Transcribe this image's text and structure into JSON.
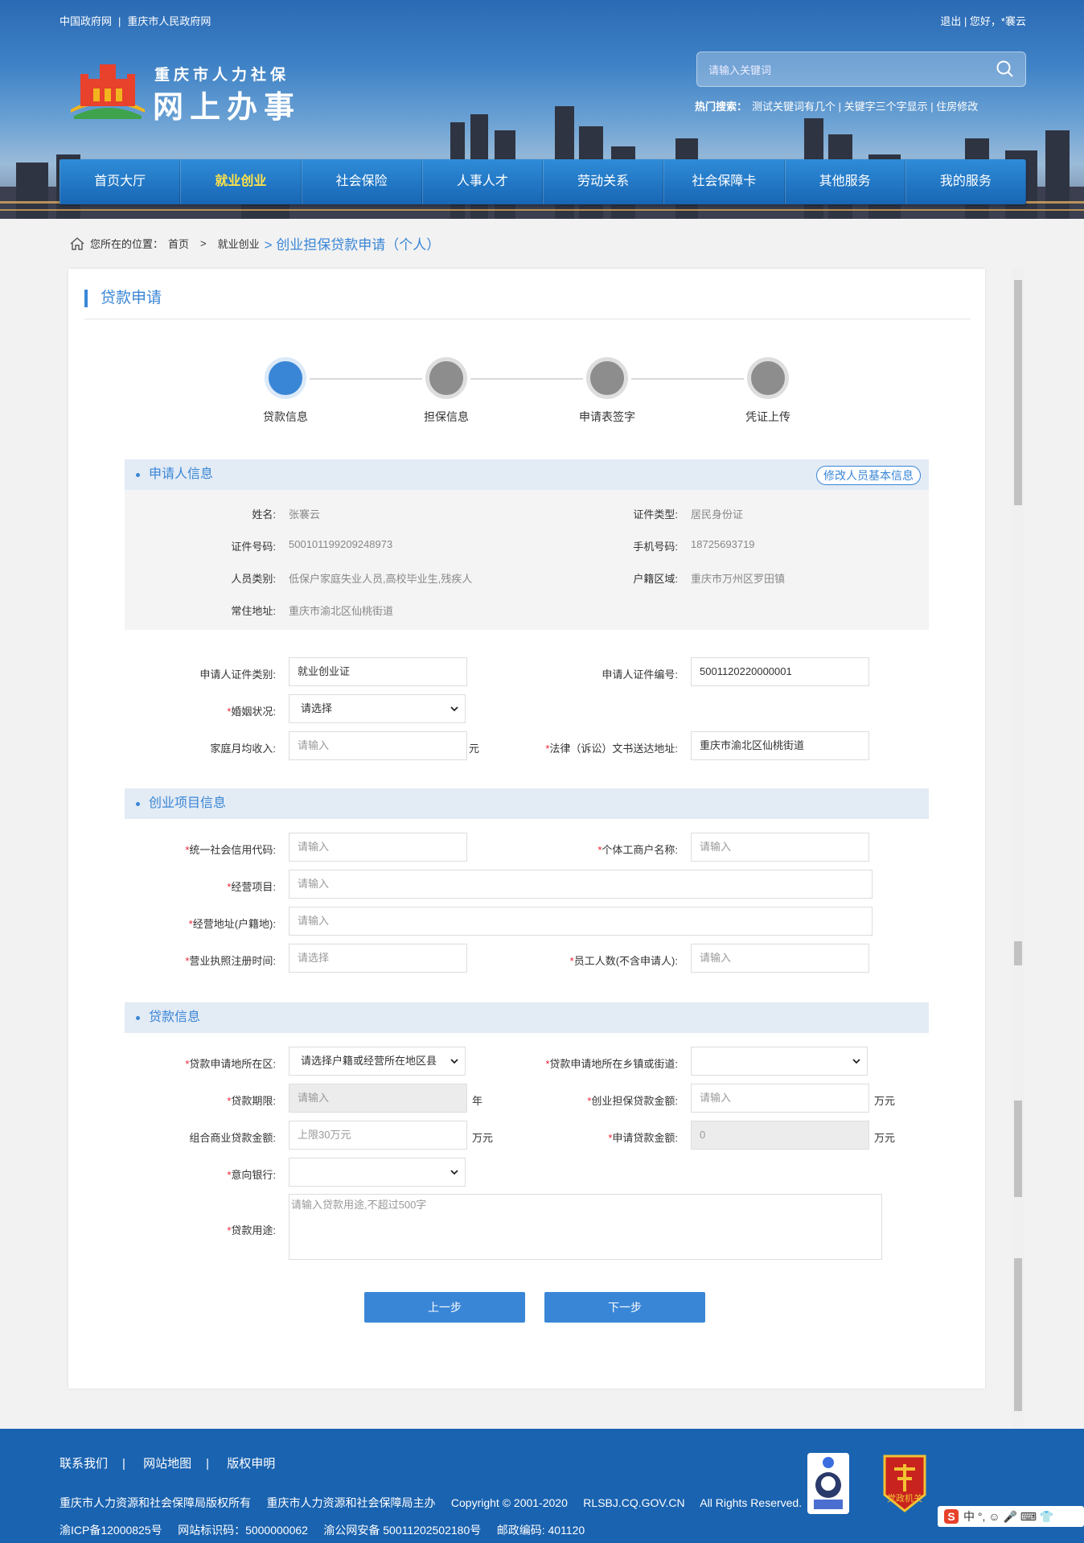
{
  "header": {
    "top_links": [
      "中国政府网",
      "重庆市人民政府网"
    ],
    "user_links": "退出 | 您好，*褰云",
    "logo_sub": "重庆市人力社保",
    "logo_main": "网上办事",
    "search_placeholder": "请输入关键词",
    "hot_label": "热门搜索：",
    "hot_items": "测试关键词有几个 | 关键字三个字显示 | 住房修改"
  },
  "nav": [
    "首页大厅",
    "就业创业",
    "社会保险",
    "人事人才",
    "劳动关系",
    "社会保障卡",
    "其他服务",
    "我的服务"
  ],
  "breadcrumb": {
    "prefix": "您所在的位置：",
    "home": "首页",
    "sep": ">",
    "level2": "就业创业",
    "current": "> 创业担保贷款申请（个人）"
  },
  "panel": {
    "title": "贷款申请"
  },
  "steps": [
    "贷款信息",
    "担保信息",
    "申请表签字",
    "凭证上传"
  ],
  "applicant": {
    "section_title": "申请人信息",
    "edit_button": "修改人员基本信息",
    "labels": {
      "name": "姓名:",
      "id_type": "证件类型:",
      "id_no": "证件号码:",
      "phone": "手机号码:",
      "category": "人员类别:",
      "hukou": "户籍区域:",
      "address": "常住地址:"
    },
    "values": {
      "name": "张褰云",
      "id_type": "居民身份证",
      "id_no": "500101199209248973",
      "phone": "18725693719",
      "category": "低保户家庭失业人员,高校毕业生,残疾人",
      "hukou": "重庆市万州区罗田镇",
      "address": "重庆市渝北区仙桃街道"
    }
  },
  "form1": {
    "cert_type_label": "申请人证件类别:",
    "cert_type_value": "就业创业证",
    "cert_no_label": "申请人证件编号:",
    "cert_no_value": "5001120220000001",
    "marital_label": "婚姻状况:",
    "marital_value": "请选择",
    "income_label": "家庭月均收入:",
    "income_placeholder": "请输入",
    "income_unit": "元",
    "legal_addr_label": "法律（诉讼）文书送达地址:",
    "legal_addr_value": "重庆市渝北区仙桃街道"
  },
  "project": {
    "section_title": "创业项目信息",
    "credit_code_label": "统一社会信用代码:",
    "credit_code_placeholder": "请输入",
    "business_name_label": "个体工商户名称:",
    "business_name_placeholder": "请输入",
    "business_item_label": "经营项目:",
    "business_item_placeholder": "请输入",
    "business_addr_label": "经营地址(户籍地):",
    "business_addr_placeholder": "请输入",
    "reg_time_label": "营业执照注册时间:",
    "reg_time_placeholder": "请选择",
    "staff_label": "员工人数(不含申请人):",
    "staff_placeholder": "请输入"
  },
  "loan": {
    "section_title": "贷款信息",
    "district_label": "贷款申请地所在区:",
    "district_value": "请选择户籍或经营所在地区县",
    "town_label": "贷款申请地所在乡镇或街道:",
    "town_value": "",
    "term_label": "贷款期限:",
    "term_placeholder": "请输入",
    "term_unit": "年",
    "guarantee_amount_label": "创业担保贷款金额:",
    "guarantee_amount_placeholder": "请输入",
    "guarantee_amount_unit": "万元",
    "commercial_label": "组合商业贷款金额:",
    "commercial_placeholder": "上限30万元",
    "commercial_unit": "万元",
    "apply_amount_label": "申请贷款金额:",
    "apply_amount_value": "0",
    "apply_amount_unit": "万元",
    "bank_label": "意向银行:",
    "bank_value": "",
    "purpose_label": "贷款用途:",
    "purpose_placeholder": "请输入贷款用途,不超过500字"
  },
  "buttons": {
    "prev": "上一步",
    "next": "下一步"
  },
  "footer": {
    "links": [
      "联系我们",
      "网站地图",
      "版权申明"
    ],
    "line1": "重庆市人力资源和社会保障局版权所有     重庆市人力资源和社会保障局主办     Copyright © 2001-2020     RLSBJ.CQ.GOV.CN     All Rights Reserved.",
    "line2": "渝ICP备12000825号     网站标识码：5000000062     渝公网安备 50011202502180号     邮政编码: 401120",
    "badge2_text": "党政机关"
  },
  "ime": {
    "text": "中 °, ☺ 🎤 ⌨ 👕"
  },
  "colors": {
    "primary": "#3a86d6",
    "nav_active": "#ffe34a",
    "footer": "#1a63b0",
    "required": "#e23"
  }
}
